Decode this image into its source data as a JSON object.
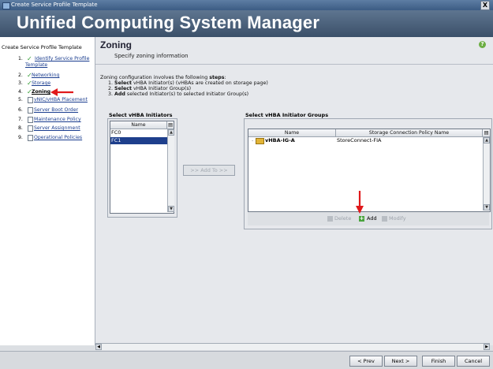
{
  "window": {
    "title": "Create Service Profile Template",
    "close_label": "X"
  },
  "banner": {
    "title": "Unified Computing System Manager"
  },
  "left_panel": {
    "title": "Create Service Profile Template",
    "steps": [
      {
        "num": "1.",
        "label": "Identify Service Profile",
        "label2": "Template",
        "state": "done"
      },
      {
        "num": "2.",
        "label": "Networking",
        "state": "done"
      },
      {
        "num": "3.",
        "label": "Storage",
        "state": "done"
      },
      {
        "num": "4.",
        "label": "Zoning",
        "state": "current"
      },
      {
        "num": "5.",
        "label": "vNIC/vHBA Placement",
        "state": "pending"
      },
      {
        "num": "6.",
        "label": "Server Boot Order",
        "state": "pending"
      },
      {
        "num": "7.",
        "label": "Maintenance Policy",
        "state": "pending"
      },
      {
        "num": "8.",
        "label": "Server Assignment",
        "state": "pending"
      },
      {
        "num": "9.",
        "label": "Operational Policies",
        "state": "pending"
      }
    ]
  },
  "main": {
    "title": "Zoning",
    "subtitle": "Specify zoning information",
    "help_icon": "?",
    "instructions": {
      "intro_pre": "Zoning configuration involves the following ",
      "intro_bold": "steps",
      "intro_post": ":",
      "steps": [
        {
          "num": "1.",
          "bold": "Select",
          "rest": " vHBA Initiator(s) (vHBAs are created on storage page)"
        },
        {
          "num": "2.",
          "bold": "Select",
          "rest": " vHBA Initiator Group(s)"
        },
        {
          "num": "3.",
          "bold": "Add",
          "rest": " selected Initiator(s) to selected Initiator Group(s)"
        }
      ]
    },
    "initiators": {
      "title": "Select vHBA Initiators",
      "column": "Name",
      "rows": [
        "FC0",
        "FC1"
      ],
      "selected_row": "FC1"
    },
    "add_to_button": ">> Add To >>",
    "groups": {
      "title": "Select vHBA Initiator Groups",
      "columns": [
        "Name",
        "Storage Connection Policy Name"
      ],
      "rows": [
        {
          "name": "vHBA-IG-A",
          "policy": "StoreConnect-FIA"
        }
      ],
      "toolbar": {
        "delete": "Delete",
        "add": "Add",
        "modify": "Modify"
      }
    }
  },
  "footer": {
    "prev": "< Prev",
    "next": "Next >",
    "finish": "Finish",
    "cancel": "Cancel"
  },
  "colors": {
    "annotation_arrow": "#e0191b",
    "selected_row": "#1e3f8c",
    "banner": "#4b6280"
  }
}
